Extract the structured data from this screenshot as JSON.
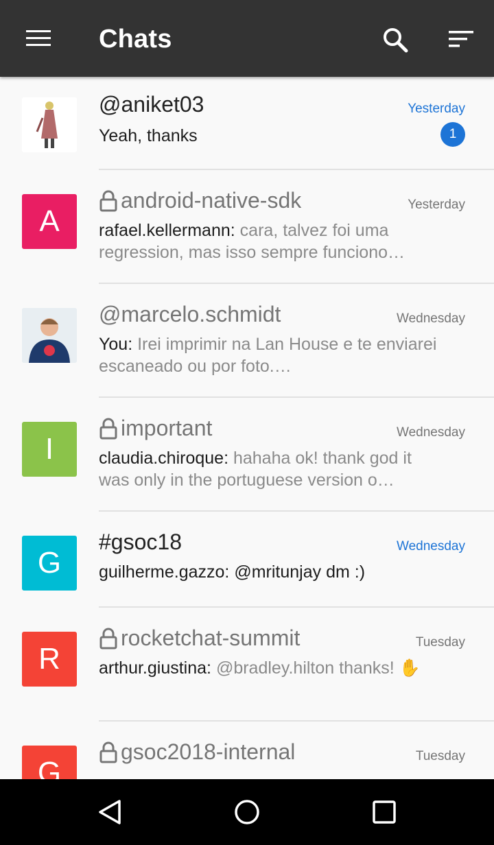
{
  "header": {
    "title": "Chats"
  },
  "chats": [
    {
      "type": "direct",
      "prefix": "@",
      "name": "aniket03",
      "time": "Yesterday",
      "unread": true,
      "unread_count": "1",
      "author": "",
      "message": "Yeah, thanks",
      "avatar": "photo"
    },
    {
      "type": "private",
      "prefix": "",
      "name": "android-native-sdk",
      "time": "Yesterday",
      "unread": false,
      "author": "rafael.kellermann:",
      "message": "cara, talvez foi uma regression, mas isso sempre funciono…",
      "avatar_letter": "A",
      "avatar_color": "#e91e63"
    },
    {
      "type": "direct",
      "prefix": "@",
      "name": "marcelo.schmidt",
      "time": "Wednesday",
      "unread": false,
      "author": "You:",
      "message": "Irei imprimir na Lan House e te enviarei escaneado ou por foto.…",
      "avatar": "photo"
    },
    {
      "type": "private",
      "prefix": "",
      "name": "important",
      "time": "Wednesday",
      "unread": false,
      "author": "claudia.chiroque:",
      "message": "hahaha ok! thank god it was only in the portuguese version o…",
      "avatar_letter": "I",
      "avatar_color": "#8bc34a"
    },
    {
      "type": "public",
      "prefix": "#",
      "name": "gsoc18",
      "time": "Wednesday",
      "unread": true,
      "author": "guilherme.gazzo:",
      "message": "@mritunjay dm :)",
      "avatar_letter": "G",
      "avatar_color": "#00bcd4"
    },
    {
      "type": "private",
      "prefix": "",
      "name": "rocketchat-summit",
      "time": "Tuesday",
      "unread": false,
      "author": "arthur.giustina:",
      "message": "@bradley.hilton thanks! ✋",
      "avatar_letter": "R",
      "avatar_color": "#f44336"
    },
    {
      "type": "private",
      "prefix": "",
      "name": "gsoc2018-internal",
      "time": "Tuesday",
      "unread": false,
      "author": "",
      "message": "",
      "avatar_letter": "G",
      "avatar_color": "#f44336"
    }
  ],
  "colors": {
    "appbar": "#333333",
    "accent": "#1d74d6",
    "navbar": "#000000"
  },
  "icons": {
    "menu": "hamburger-icon",
    "search": "search-icon",
    "sort": "sort-icon",
    "lock": "lock-icon",
    "back": "back-triangle-icon",
    "home": "home-circle-icon",
    "recents": "recents-square-icon"
  }
}
